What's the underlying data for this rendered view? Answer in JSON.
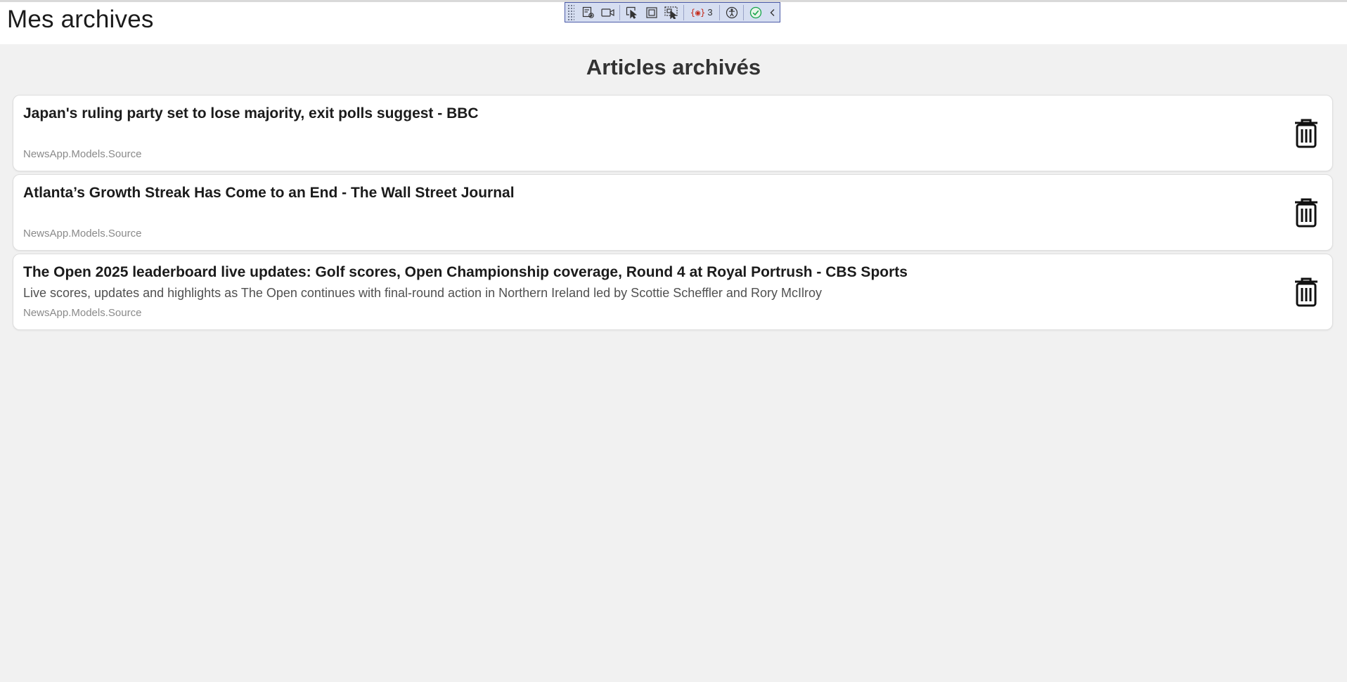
{
  "app": {
    "title": "Mes archives"
  },
  "devbar": {
    "binding_error_count": "3"
  },
  "page": {
    "heading": "Articles archivés"
  },
  "articles": [
    {
      "title": "Japan's ruling party set to lose majority, exit polls suggest - BBC",
      "description": "",
      "source": "NewsApp.Models.Source",
      "delete_icon": "trash-icon"
    },
    {
      "title": "Atlanta’s Growth Streak Has Come to an End - The Wall Street Journal",
      "description": "",
      "source": "NewsApp.Models.Source",
      "delete_icon": "trash-icon"
    },
    {
      "title": "The Open 2025 leaderboard live updates: Golf scores, Open Championship coverage, Round 4 at Royal Portrush - CBS Sports",
      "description": "Live scores, updates and highlights as The Open continues with final-round action in Northern Ireland led by Scottie Scheffler and Rory McIlroy",
      "source": "NewsApp.Models.Source",
      "delete_icon": "trash-icon"
    }
  ],
  "colors": {
    "background": "#f1f1f1",
    "card": "#ffffff",
    "devbar_bg": "#d6def1",
    "devbar_border": "#4b5aa8",
    "error_accent": "#c42b1c",
    "ok_accent": "#16a34a"
  }
}
